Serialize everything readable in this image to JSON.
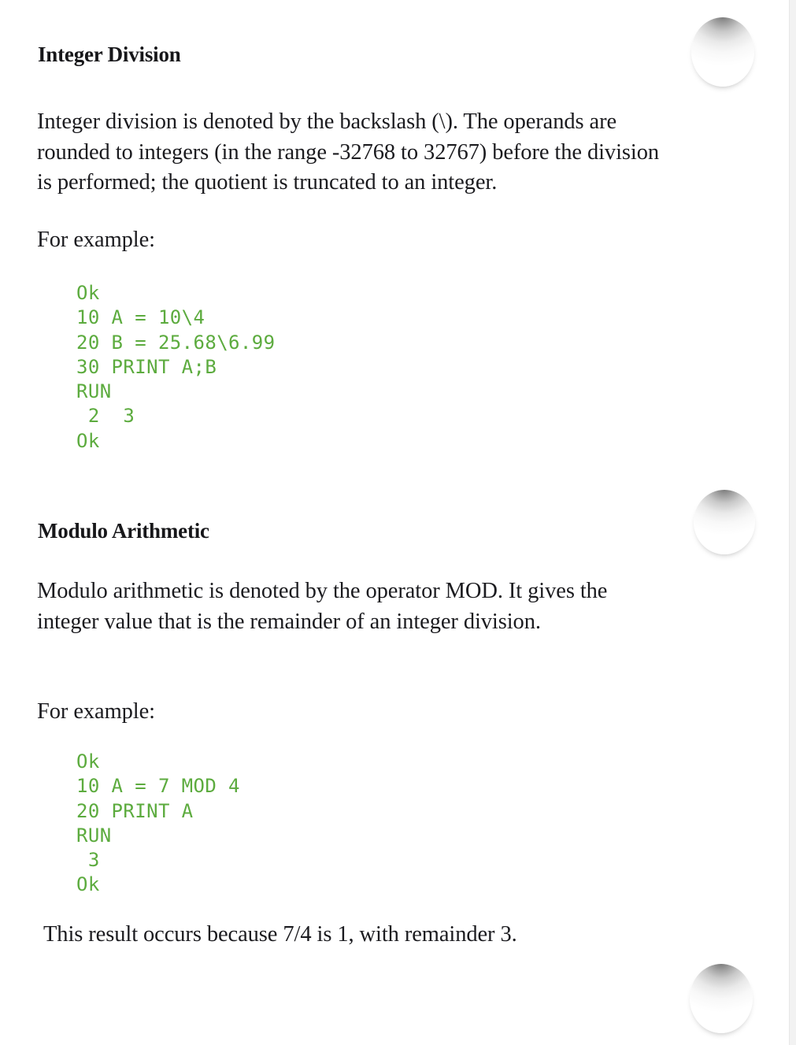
{
  "page": {
    "paper_color": "#ffffff",
    "edge_strip_color": "#f2f2f2",
    "code_color": "#5cab3e",
    "text_color": "#1b1b1f"
  },
  "holes": [
    {
      "name": "binder-hole-top"
    },
    {
      "name": "binder-hole-middle"
    },
    {
      "name": "binder-hole-bottom"
    }
  ],
  "sections": {
    "integer_division": {
      "heading": "Integer Division",
      "paragraph": "Integer division is denoted by the backslash (\\).  The operands are rounded to integers (in the range -32768 to 32767) before the division is performed; the quotient is truncated to an integer.",
      "for_example": "For example:",
      "code": "Ok\n10 A = 10\\4\n20 B = 25.68\\6.99\n30 PRINT A;B\nRUN\n 2  3\nOk"
    },
    "modulo_arithmetic": {
      "heading": "Modulo Arithmetic",
      "paragraph": "Modulo arithmetic is denoted by the operator MOD.  It gives the integer value that is the remainder of an integer division.",
      "for_example": "For example:",
      "code": "Ok\n10 A = 7 MOD 4\n20 PRINT A\nRUN\n 3\nOk",
      "closing_note": "This result occurs because 7/4 is 1, with remainder 3."
    }
  }
}
